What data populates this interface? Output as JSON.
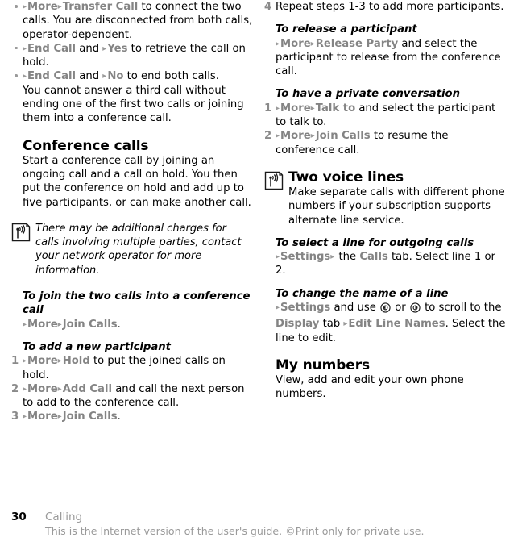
{
  "document": {
    "page_number": "30",
    "chapter": "Calling",
    "footer_notice": "This is the Internet version of the user's guide. ©Print only for private use."
  },
  "icons": {
    "note": "antenna-transmit-icon",
    "section": "antenna-transmit-icon",
    "arrow": "▸",
    "joystick_left": "joystick-left-icon",
    "joystick_right": "joystick-right-icon"
  },
  "left_column": {
    "bullets": [
      {
        "marker": "•",
        "parts": [
          {
            "t": "arrow"
          },
          {
            "t": "ui",
            "v": "More"
          },
          {
            "t": "arrow"
          },
          {
            "t": "ui",
            "v": "Transfer Call"
          },
          {
            "t": "text",
            "v": " to connect the two calls. You are disconnected from both calls, operator-dependent."
          }
        ]
      },
      {
        "marker": "•",
        "parts": [
          {
            "t": "arrow"
          },
          {
            "t": "ui",
            "v": "End Call"
          },
          {
            "t": "text",
            "v": " and "
          },
          {
            "t": "arrow"
          },
          {
            "t": "ui",
            "v": "Yes"
          },
          {
            "t": "text",
            "v": " to retrieve the call on hold."
          }
        ]
      },
      {
        "marker": "•",
        "parts": [
          {
            "t": "arrow"
          },
          {
            "t": "ui",
            "v": "End Call"
          },
          {
            "t": "text",
            "v": " and "
          },
          {
            "t": "arrow"
          },
          {
            "t": "ui",
            "v": "No"
          },
          {
            "t": "text",
            "v": " to end both calls."
          }
        ]
      }
    ],
    "after_bullets_paragraph": "You cannot answer a third call without ending one of the first two calls or joining them into a conference call.",
    "conference_heading": "Conference calls",
    "conference_intro": "Start a conference call by joining an ongoing call and a call on hold. You then put the conference on hold and add up to five participants, or can make another call.",
    "note_text": "There may be additional charges for calls involving multiple parties, contact your network operator for more information.",
    "join_heading": "To join the two calls into a conference call",
    "join_steps": [
      {
        "marker": "",
        "parts": [
          {
            "t": "arrow"
          },
          {
            "t": "ui",
            "v": "More"
          },
          {
            "t": "arrow"
          },
          {
            "t": "ui",
            "v": "Join Calls"
          },
          {
            "t": "text",
            "v": "."
          }
        ]
      }
    ],
    "add_heading": "To add a new participant",
    "add_steps": [
      {
        "marker": "1",
        "parts": [
          {
            "t": "arrow"
          },
          {
            "t": "ui",
            "v": "More"
          },
          {
            "t": "arrow"
          },
          {
            "t": "ui",
            "v": "Hold"
          },
          {
            "t": "text",
            "v": " to put the joined calls on hold."
          }
        ]
      },
      {
        "marker": "2",
        "parts": [
          {
            "t": "arrow"
          },
          {
            "t": "ui",
            "v": "More"
          },
          {
            "t": "arrow"
          },
          {
            "t": "ui",
            "v": "Add Call"
          },
          {
            "t": "text",
            "v": " and call the next person to add to the conference call."
          }
        ]
      },
      {
        "marker": "3",
        "parts": [
          {
            "t": "arrow"
          },
          {
            "t": "ui",
            "v": "More"
          },
          {
            "t": "arrow"
          },
          {
            "t": "ui",
            "v": "Join Calls"
          },
          {
            "t": "text",
            "v": "."
          }
        ]
      }
    ]
  },
  "right_column": {
    "add_steps_continued": [
      {
        "marker": "4",
        "parts": [
          {
            "t": "text",
            "v": "Repeat steps 1-3 to add more participants."
          }
        ]
      }
    ],
    "release_heading": "To release a participant",
    "release_steps": [
      {
        "marker": "",
        "parts": [
          {
            "t": "arrow"
          },
          {
            "t": "ui",
            "v": "More"
          },
          {
            "t": "arrow"
          },
          {
            "t": "ui",
            "v": "Release Party"
          },
          {
            "t": "text",
            "v": " and select the participant to release from the conference call."
          }
        ]
      }
    ],
    "private_heading": "To have a private conversation",
    "private_steps": [
      {
        "marker": "1",
        "parts": [
          {
            "t": "arrow"
          },
          {
            "t": "ui",
            "v": "More"
          },
          {
            "t": "arrow"
          },
          {
            "t": "ui",
            "v": "Talk to"
          },
          {
            "t": "text",
            "v": " and select the participant to talk to."
          }
        ]
      },
      {
        "marker": "2",
        "parts": [
          {
            "t": "arrow"
          },
          {
            "t": "ui",
            "v": "More"
          },
          {
            "t": "arrow"
          },
          {
            "t": "ui",
            "v": "Join Calls"
          },
          {
            "t": "text",
            "v": " to resume the conference call."
          }
        ]
      }
    ],
    "voice_lines_heading": "Two voice lines",
    "voice_lines_intro": "Make separate calls with different phone numbers if your subscription supports alternate line service.",
    "select_line_heading": "To select a line for outgoing calls",
    "select_line_steps": [
      {
        "marker": "",
        "parts": [
          {
            "t": "arrow"
          },
          {
            "t": "ui",
            "v": "Settings"
          },
          {
            "t": "arrow"
          },
          {
            "t": "text",
            "v": " the "
          },
          {
            "t": "ui",
            "v": "Calls"
          },
          {
            "t": "text",
            "v": " tab. Select line 1 or 2."
          }
        ]
      }
    ],
    "change_name_heading": "To change the name of a line",
    "change_name_steps": [
      {
        "marker": "",
        "parts": [
          {
            "t": "arrow"
          },
          {
            "t": "ui",
            "v": "Settings"
          },
          {
            "t": "text",
            "v": " and use "
          },
          {
            "t": "icon",
            "v": "joystick_left"
          },
          {
            "t": "text",
            "v": " or "
          },
          {
            "t": "icon",
            "v": "joystick_right"
          },
          {
            "t": "text",
            "v": " to scroll to the "
          },
          {
            "t": "ui",
            "v": "Display"
          },
          {
            "t": "text",
            "v": " tab "
          },
          {
            "t": "arrow"
          },
          {
            "t": "ui",
            "v": "Edit Line Names"
          },
          {
            "t": "text",
            "v": ". Select the line to edit."
          }
        ]
      }
    ],
    "my_numbers_heading": "My numbers",
    "my_numbers_text": "View, add and edit your own phone numbers."
  }
}
